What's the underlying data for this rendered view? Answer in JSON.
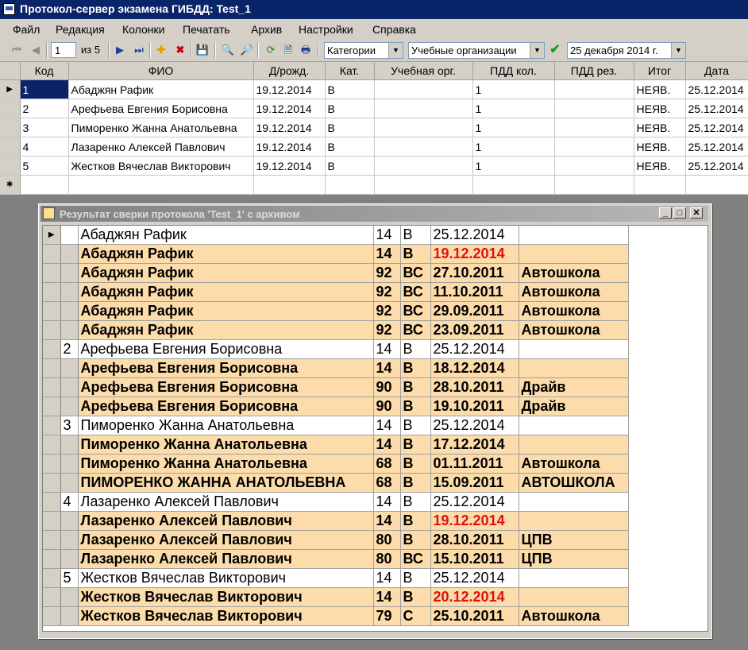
{
  "window": {
    "title": "Протокол-сервер экзамена ГИБДД: Test_1"
  },
  "menu": [
    "Файл",
    "Редакция",
    "Колонки",
    "Печатать",
    "Архив",
    "Настройки",
    "Справка"
  ],
  "toolbar": {
    "record_position": "1",
    "record_total": "из 5",
    "category_filter": "Категории",
    "org_filter": "Учебные организации",
    "date": "25 декабря  2014 г."
  },
  "grid": {
    "headers": [
      "Код",
      "ФИО",
      "Д/рожд.",
      "Кат.",
      "Учебная орг.",
      "ПДД кол.",
      "ПДД рез.",
      "Итог",
      "Дата"
    ],
    "rows": [
      {
        "code": "1",
        "name": "Абаджян Рафик",
        "birth": "19.12.2014",
        "cat": "В",
        "org": "",
        "pdd_count": "1",
        "pdd_res": "",
        "result": "НЕЯВ.",
        "date": "25.12.2014"
      },
      {
        "code": "2",
        "name": "Арефьева Евгения Борисовна",
        "birth": "19.12.2014",
        "cat": "В",
        "org": "",
        "pdd_count": "1",
        "pdd_res": "",
        "result": "НЕЯВ.",
        "date": "25.12.2014"
      },
      {
        "code": "3",
        "name": "Пиморенко Жанна Анатольевна",
        "birth": "19.12.2014",
        "cat": "В",
        "org": "",
        "pdd_count": "1",
        "pdd_res": "",
        "result": "НЕЯВ.",
        "date": "25.12.2014"
      },
      {
        "code": "4",
        "name": "Лазаренко Алексей Павлович",
        "birth": "19.12.2014",
        "cat": "В",
        "org": "",
        "pdd_count": "1",
        "pdd_res": "",
        "result": "НЕЯВ.",
        "date": "25.12.2014"
      },
      {
        "code": "5",
        "name": "Жестков Вячеслав Викторович",
        "birth": "19.12.2014",
        "cat": "В",
        "org": "",
        "pdd_count": "1",
        "pdd_res": "",
        "result": "НЕЯВ.",
        "date": "25.12.2014"
      }
    ]
  },
  "dialog": {
    "title": "Результат сверки протокола 'Test_1' с архивом",
    "rows": [
      {
        "kind": "current",
        "num": "1",
        "name": "Абаджян Рафик",
        "n": "14",
        "cat": "В",
        "date": "25.12.2014",
        "org": "",
        "red": false
      },
      {
        "kind": "archive",
        "num": "",
        "name": "Абаджян Рафик",
        "n": "14",
        "cat": "В",
        "date": "19.12.2014",
        "org": "",
        "red": true
      },
      {
        "kind": "archive",
        "num": "",
        "name": "Абаджян Рафик",
        "n": "92",
        "cat": "ВС",
        "date": "27.10.2011",
        "org": "Автошкола",
        "red": false
      },
      {
        "kind": "archive",
        "num": "",
        "name": "Абаджян Рафик",
        "n": "92",
        "cat": "ВС",
        "date": "11.10.2011",
        "org": "Автошкола",
        "red": false
      },
      {
        "kind": "archive",
        "num": "",
        "name": "Абаджян Рафик",
        "n": "92",
        "cat": "ВС",
        "date": "29.09.2011",
        "org": "Автошкола",
        "red": false
      },
      {
        "kind": "archive",
        "num": "",
        "name": "Абаджян Рафик",
        "n": "92",
        "cat": "ВС",
        "date": "23.09.2011",
        "org": "Автошкола",
        "red": false
      },
      {
        "kind": "current",
        "num": "2",
        "name": "Арефьева Евгения Борисовна",
        "n": "14",
        "cat": "В",
        "date": "25.12.2014",
        "org": "",
        "red": false
      },
      {
        "kind": "archive",
        "num": "",
        "name": "Арефьева Евгения Борисовна",
        "n": "14",
        "cat": "В",
        "date": "18.12.2014",
        "org": "",
        "red": false
      },
      {
        "kind": "archive",
        "num": "",
        "name": "Арефьева Евгения Борисовна",
        "n": "90",
        "cat": "В",
        "date": "28.10.2011",
        "org": "Драйв",
        "red": false
      },
      {
        "kind": "archive",
        "num": "",
        "name": "Арефьева Евгения Борисовна",
        "n": "90",
        "cat": "В",
        "date": "19.10.2011",
        "org": "Драйв",
        "red": false
      },
      {
        "kind": "current",
        "num": "3",
        "name": "Пиморенко Жанна Анатольевна",
        "n": "14",
        "cat": "В",
        "date": "25.12.2014",
        "org": "",
        "red": false
      },
      {
        "kind": "archive",
        "num": "",
        "name": "Пиморенко Жанна Анатольевна",
        "n": "14",
        "cat": "В",
        "date": "17.12.2014",
        "org": "",
        "red": false
      },
      {
        "kind": "archive",
        "num": "",
        "name": "Пиморенко Жанна Анатольевна",
        "n": "68",
        "cat": "В",
        "date": "01.11.2011",
        "org": "Автошкола",
        "red": false
      },
      {
        "kind": "archive",
        "num": "",
        "name": "ПИМОРЕНКО ЖАННА АНАТОЛЬЕВНА",
        "n": "68",
        "cat": "В",
        "date": "15.09.2011",
        "org": "АВТОШКОЛА",
        "red": false
      },
      {
        "kind": "current",
        "num": "4",
        "name": "Лазаренко Алексей Павлович",
        "n": "14",
        "cat": "В",
        "date": "25.12.2014",
        "org": "",
        "red": false
      },
      {
        "kind": "archive",
        "num": "",
        "name": "Лазаренко Алексей Павлович",
        "n": "14",
        "cat": "В",
        "date": "19.12.2014",
        "org": "",
        "red": true
      },
      {
        "kind": "archive",
        "num": "",
        "name": "Лазаренко Алексей Павлович",
        "n": "80",
        "cat": "В",
        "date": "28.10.2011",
        "org": "ЦПВ",
        "red": false
      },
      {
        "kind": "archive",
        "num": "",
        "name": "Лазаренко Алексей Павлович",
        "n": "80",
        "cat": "ВС",
        "date": "15.10.2011",
        "org": "ЦПВ",
        "red": false
      },
      {
        "kind": "current",
        "num": "5",
        "name": "Жестков Вячеслав Викторович",
        "n": "14",
        "cat": "В",
        "date": "25.12.2014",
        "org": "",
        "red": false
      },
      {
        "kind": "archive",
        "num": "",
        "name": "Жестков Вячеслав Викторович",
        "n": "14",
        "cat": "В",
        "date": "20.12.2014",
        "org": "",
        "red": true
      },
      {
        "kind": "archive",
        "num": "",
        "name": "Жестков Вячеслав Викторович",
        "n": "79",
        "cat": "С",
        "date": "25.10.2011",
        "org": "Автошкола",
        "red": false
      }
    ]
  },
  "colors": {
    "title_bar": "#0a246a",
    "archive_row": "#fcdcaa",
    "mismatch": "#e01010"
  }
}
